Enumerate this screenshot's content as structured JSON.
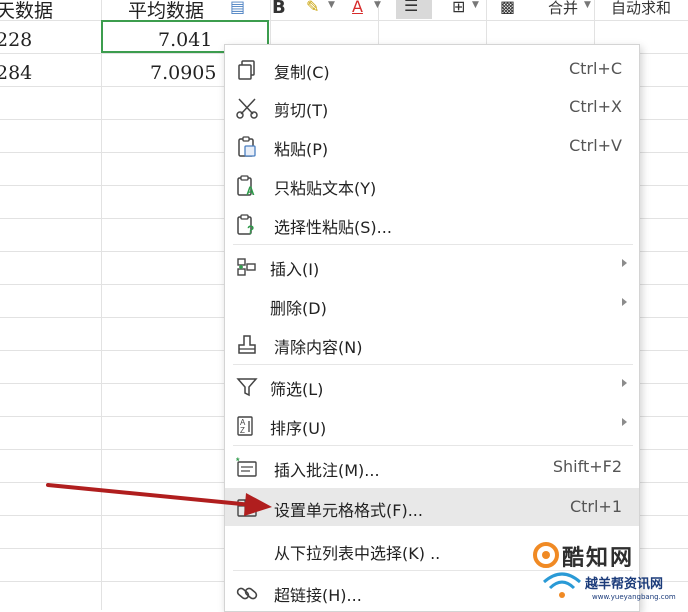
{
  "sheet": {
    "header_cells": [
      "天数据",
      "平均数据"
    ],
    "rows": [
      [
        "228",
        "7.041"
      ],
      [
        "284",
        "7.0905"
      ]
    ]
  },
  "toolbar": {
    "bold": "B",
    "font_color": "A",
    "merge_label": "合并",
    "autosum_label": "自动求和"
  },
  "menu": {
    "items": [
      {
        "label": "复制(C)",
        "shortcut": "Ctrl+C"
      },
      {
        "label": "剪切(T)",
        "shortcut": "Ctrl+X"
      },
      {
        "label": "粘贴(P)",
        "shortcut": "Ctrl+V"
      },
      {
        "label": "只粘贴文本(Y)",
        "shortcut": ""
      },
      {
        "label": "选择性粘贴(S)...",
        "shortcut": ""
      },
      {
        "label": "插入(I)",
        "shortcut": ""
      },
      {
        "label": "删除(D)",
        "shortcut": ""
      },
      {
        "label": "清除内容(N)",
        "shortcut": ""
      },
      {
        "label": "筛选(L)",
        "shortcut": ""
      },
      {
        "label": "排序(U)",
        "shortcut": ""
      },
      {
        "label": "插入批注(M)...",
        "shortcut": "Shift+F2"
      },
      {
        "label": "设置单元格格式(F)...",
        "shortcut": "Ctrl+1"
      },
      {
        "label": "从下拉列表中选择(K) ..",
        "shortcut": ""
      },
      {
        "label": "超链接(H)...",
        "shortcut": ""
      }
    ]
  },
  "watermark": {
    "brand": "酷知网",
    "site_name": "越羊帮资讯网",
    "site_url": "www.yueyangbang.com"
  },
  "colors": {
    "selection_border": "#3c9d4e",
    "arrow": "#b01e1e",
    "highlight": "#e8e8e8"
  }
}
